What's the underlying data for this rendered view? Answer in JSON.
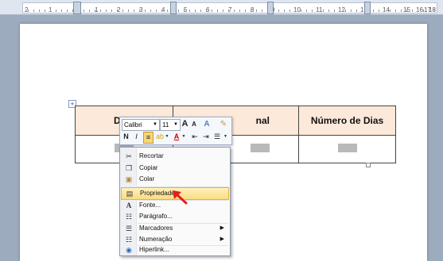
{
  "ruler": {
    "numbers": [
      "2",
      "1",
      "1",
      "2",
      "3",
      "4",
      "5",
      "6",
      "7",
      "8",
      "9",
      "10",
      "11",
      "12",
      "13",
      "14",
      "15",
      "16",
      "17",
      "18"
    ]
  },
  "table": {
    "headers": [
      "Data",
      "nal",
      "Número de Dias"
    ]
  },
  "minitoolbar": {
    "font": "Calibri",
    "size": "11",
    "grow": "A",
    "shrink": "A",
    "bold": "N",
    "italic": "I",
    "font_color": "A"
  },
  "context_menu": {
    "items": [
      {
        "label": "Recortar",
        "icon": "scissors-icon"
      },
      {
        "label": "Copiar",
        "icon": "copy-icon"
      },
      {
        "label": "Colar",
        "icon": "paste-icon"
      },
      {
        "label": "Propriedades",
        "icon": "properties-icon",
        "highlighted": true
      },
      {
        "label": "Fonte...",
        "icon": "font-icon"
      },
      {
        "label": "Parágrafo...",
        "icon": "paragraph-icon"
      },
      {
        "label": "Marcadores",
        "icon": "bullets-icon",
        "submenu": true
      },
      {
        "label": "Numeração",
        "icon": "numbering-icon",
        "submenu": true
      },
      {
        "label": "Hiperlink...",
        "icon": "hyperlink-icon"
      }
    ]
  },
  "colors": {
    "header_fill": "#fde9d9",
    "highlight": "#fbdc7f",
    "arrow": "#e0201b"
  }
}
